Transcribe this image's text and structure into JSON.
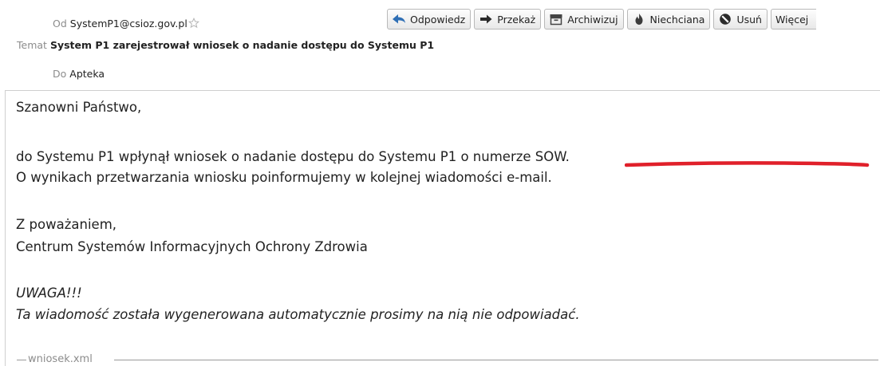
{
  "header": {
    "from_label": "Od",
    "from_value": "SystemP1@csioz.gov.pl",
    "subject_label": "Temat",
    "subject_value": "System P1 zarejestrował wniosek o nadanie dostępu do Systemu P1",
    "to_label": "Do",
    "to_value": "Apteka"
  },
  "toolbar": {
    "reply": "Odpowiedz",
    "forward": "Przekaż",
    "archive": "Archiwizuj",
    "junk": "Niechciana",
    "delete": "Usuń",
    "more": "Więcej"
  },
  "message": {
    "greeting": "Szanowni Państwo,",
    "line1": "do Systemu P1 wpłynął wniosek o nadanie dostępu do Systemu P1 o numerze SOW.",
    "line2": "O wynikach przetwarzania wniosku poinformujemy w kolejnej wiadomości e-mail.",
    "closing": "Z poważaniem,",
    "signature": "Centrum Systemów Informacyjnych Ochrony Zdrowia",
    "warning_title": "UWAGA!!!",
    "warning_text": "Ta wiadomość została wygenerowana automatycznie prosimy na nią nie odpowiadać."
  },
  "attachment": {
    "name": "wniosek.xml"
  },
  "colors": {
    "annotation": "#e0202a",
    "label": "#8c8c8c"
  }
}
